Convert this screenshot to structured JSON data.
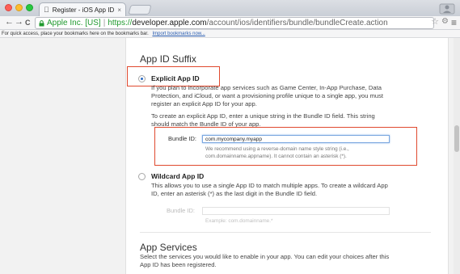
{
  "browser": {
    "tab_title": "Register - iOS App IDs - A",
    "tab_close": "×",
    "back": "←",
    "forward": "→",
    "reload": "C",
    "ssl_owner": "Apple Inc. [US]",
    "url_scheme": "https://",
    "url_host": "developer.apple.com",
    "url_path": "/account/ios/identifiers/bundle/bundleCreate.action",
    "bookmarks_text": "For quick access, place your bookmarks here on the bookmarks bar.",
    "import_link": "Import bookmarks now..."
  },
  "page": {
    "suffix_title": "App ID Suffix",
    "explicit": {
      "title": "Explicit App ID",
      "desc_lines": [
        "If you plan to incorporate app services such as Game Center, In-App Purchase, Data",
        "Protection, and iCloud, or want a provisioning profile unique to a single app, you must",
        "register an explicit App ID for your app."
      ],
      "instr_lines": [
        "To create an explicit App ID, enter a unique string in the Bundle ID field. This string",
        "should match the Bundle ID of your app."
      ],
      "bundle_label": "Bundle ID:",
      "bundle_value": "com.mycompany.myapp",
      "hint_lines": [
        "We recommend using a reverse-domain name style string (i.e.,",
        "com.domainname.appname). It cannot contain an asterisk (*)."
      ]
    },
    "wildcard": {
      "title": "Wildcard App ID",
      "desc_lines": [
        "This allows you to use a single App ID to match multiple apps. To create a wildcard App",
        "ID, enter an asterisk (*) as the last digit in the Bundle ID field."
      ],
      "bundle_label": "Bundle ID:",
      "bundle_value": "",
      "example": "Example: com.domainname.*"
    },
    "services_title": "App Services",
    "services_lines": [
      "Select the services you would like to enable in your app. You can edit your choices after this",
      "App ID has been registered."
    ]
  },
  "colors": {
    "highlight_box": "#e04a2f",
    "link": "#2a5db0",
    "secure": "#1f9a2e"
  }
}
